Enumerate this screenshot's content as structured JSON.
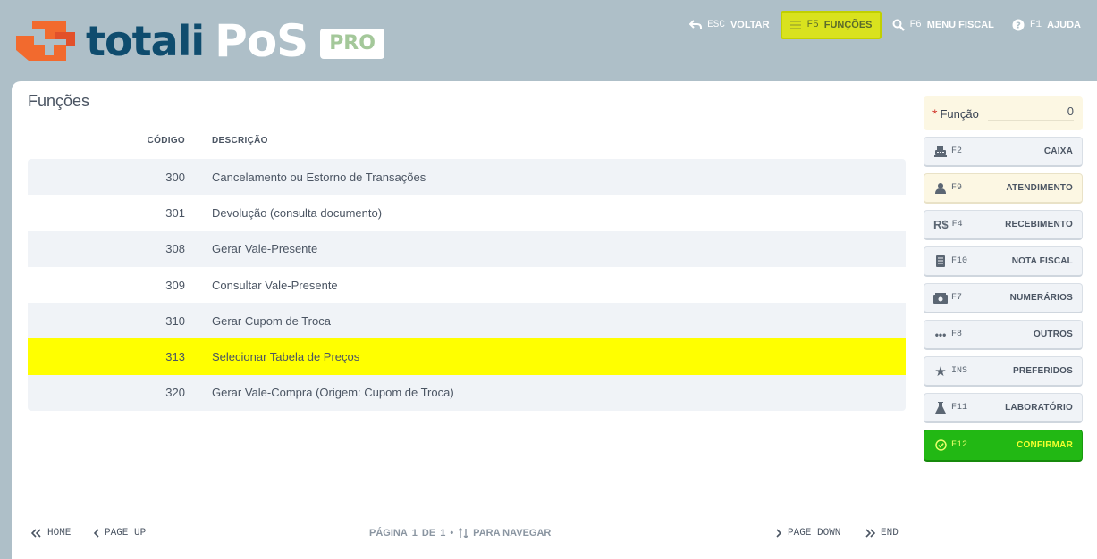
{
  "brand": {
    "name": "totali",
    "product": "PoS",
    "edition": "PRO"
  },
  "topnav": [
    {
      "key": "ESC",
      "label": "VOLTAR",
      "icon": "back-arrow-icon"
    },
    {
      "key": "F5",
      "label": "FUNÇÕES",
      "icon": "menu-lines-icon",
      "active": true
    },
    {
      "key": "F6",
      "label": "MENU FISCAL",
      "icon": "search-icon"
    },
    {
      "key": "F1",
      "label": "AJUDA",
      "icon": "help-icon"
    }
  ],
  "page": {
    "title": "Funções"
  },
  "table": {
    "headers": {
      "code": "CÓDIGO",
      "description": "DESCRIÇÃO"
    },
    "rows": [
      {
        "code": "300",
        "description": "Cancelamento ou Estorno de Transações"
      },
      {
        "code": "301",
        "description": "Devolução (consulta documento)"
      },
      {
        "code": "308",
        "description": "Gerar Vale-Presente"
      },
      {
        "code": "309",
        "description": "Consultar Vale-Presente"
      },
      {
        "code": "310",
        "description": "Gerar Cupom de Troca"
      },
      {
        "code": "313",
        "description": "Selecionar Tabela de Preços",
        "selected": true
      },
      {
        "code": "320",
        "description": "Gerar Vale-Compra (Origem: Cupom de Troca)"
      }
    ]
  },
  "footer": {
    "home": "HOME",
    "page_up": "PAGE UP",
    "pagination": {
      "pagina": "PÁGINA",
      "current": "1",
      "de": "DE",
      "total": "1",
      "navigate": "PARA NAVEGAR"
    },
    "page_down": "PAGE DOWN",
    "end": "END"
  },
  "sidebar": {
    "funcao": {
      "label": "Função",
      "value": "0"
    },
    "buttons": [
      {
        "key": "F2",
        "label": "CAIXA",
        "icon": "cash-register-icon"
      },
      {
        "key": "F9",
        "label": "ATENDIMENTO",
        "icon": "user-icon",
        "highlight": true
      },
      {
        "key": "F4",
        "label": "RECEBIMENTO",
        "icon": "real-currency-icon"
      },
      {
        "key": "F10",
        "label": "NOTA FISCAL",
        "icon": "document-icon"
      },
      {
        "key": "F7",
        "label": "NUMERÁRIOS",
        "icon": "money-icon"
      },
      {
        "key": "F8",
        "label": "OUTROS",
        "icon": "ellipsis-icon"
      },
      {
        "key": "INS",
        "label": "PREFERIDOS",
        "icon": "star-icon"
      },
      {
        "key": "F11",
        "label": "LABORATÓRIO",
        "icon": "flask-icon"
      },
      {
        "key": "F12",
        "label": "CONFIRMAR",
        "icon": "check-circle-icon",
        "confirm": true
      }
    ]
  },
  "colors": {
    "background": "#aebfc8",
    "brand_navy": "#0f4c6e",
    "brand_orange": "#f26a2e",
    "selected_row": "#ffff00",
    "confirm": "#22b814",
    "active_nav": "#d9e21e"
  }
}
